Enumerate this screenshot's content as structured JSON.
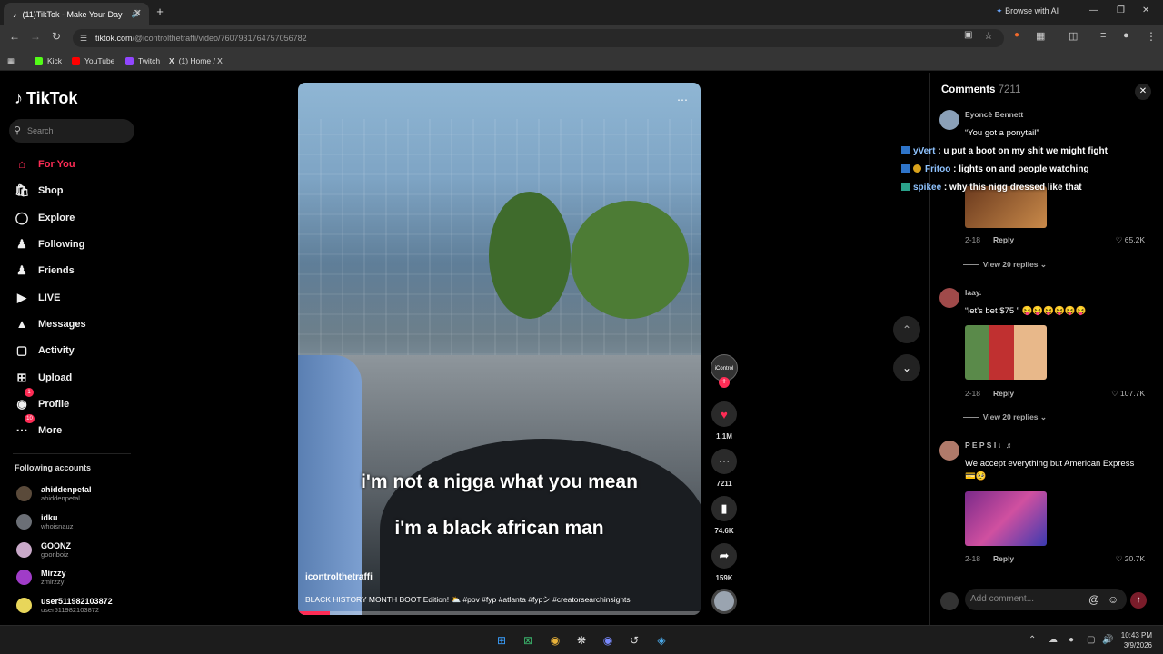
{
  "browser": {
    "tab_title": "(11)TikTok - Make Your Day",
    "url_host": "tiktok.com",
    "url_path": "/@icontrolthetraffi/video/7607931764757056782",
    "browse_ai": "Browse with AI",
    "bookmarks": [
      "Kick",
      "YouTube",
      "Twitch",
      "(1) Home / X"
    ]
  },
  "sidebar": {
    "logo": "TikTok",
    "search_placeholder": "Search",
    "nav": [
      {
        "label": "For You",
        "icon": "home-icon"
      },
      {
        "label": "Shop",
        "icon": "shop-icon"
      },
      {
        "label": "Explore",
        "icon": "compass-icon"
      },
      {
        "label": "Following",
        "icon": "following-icon"
      },
      {
        "label": "Friends",
        "icon": "friends-icon"
      },
      {
        "label": "LIVE",
        "icon": "live-icon"
      },
      {
        "label": "Messages",
        "icon": "messages-icon",
        "badge": "1"
      },
      {
        "label": "Activity",
        "icon": "activity-icon",
        "badge": "10"
      },
      {
        "label": "Upload",
        "icon": "upload-icon"
      },
      {
        "label": "Profile",
        "icon": "profile-icon"
      },
      {
        "label": "More",
        "icon": "more-icon"
      }
    ],
    "following_title": "Following accounts",
    "accounts": [
      {
        "name": "ahiddenpetal",
        "handle": "ahiddenpetal"
      },
      {
        "name": "idku",
        "handle": "whoisnauz"
      },
      {
        "name": "GOONZ",
        "handle": "goonboiz"
      },
      {
        "name": "Mirzzy",
        "handle": "zmirzzy"
      },
      {
        "name": "user511982103872",
        "handle": "user511982103872"
      }
    ]
  },
  "video": {
    "caption_line1": "i'm not a nigga what you mean",
    "caption_line2": "i'm a black african man",
    "username": "icontrolthetraffi",
    "description": "BLACK HISTORY MONTH BOOT Edition! ⛅ #pov #fyp #atlanta #fypシ #creatorsearchinsights",
    "progress": 0.08
  },
  "actions": {
    "likes": "1.1M",
    "comments": "7211",
    "saves": "74.6K",
    "shares": "159K",
    "creator_badge": "iControl"
  },
  "comments": {
    "title": "Comments",
    "count": "7211",
    "items": [
      {
        "name": "Eyoncè Bennett",
        "text": "“You got a ponytail”",
        "date": "2-18",
        "reply": "Reply",
        "likes": "65.2K",
        "view_replies": "View 20 replies"
      },
      {
        "name": "laay.",
        "text": "“let's bet $75 ” 😝😝😝😝😝😝",
        "date": "2-18",
        "reply": "Reply",
        "likes": "107.7K",
        "view_replies": "View 20 replies"
      },
      {
        "name": "P E P S I ♩♬",
        "text": "We accept everything but American Express 💳🥺",
        "date": "2-18",
        "reply": "Reply",
        "likes": "20.7K"
      }
    ],
    "add_placeholder": "Add comment..."
  },
  "overlay_chat": [
    {
      "user": "yVert",
      "msg": " : u put a boot on my shit we might fight"
    },
    {
      "user": "Fritoo",
      "msg": " : lights on and people watching"
    },
    {
      "user": "spikee",
      "msg": " : why this nigg dressed like that"
    }
  ],
  "taskbar": {
    "time": "10:43 PM",
    "date": "3/9/2026"
  }
}
